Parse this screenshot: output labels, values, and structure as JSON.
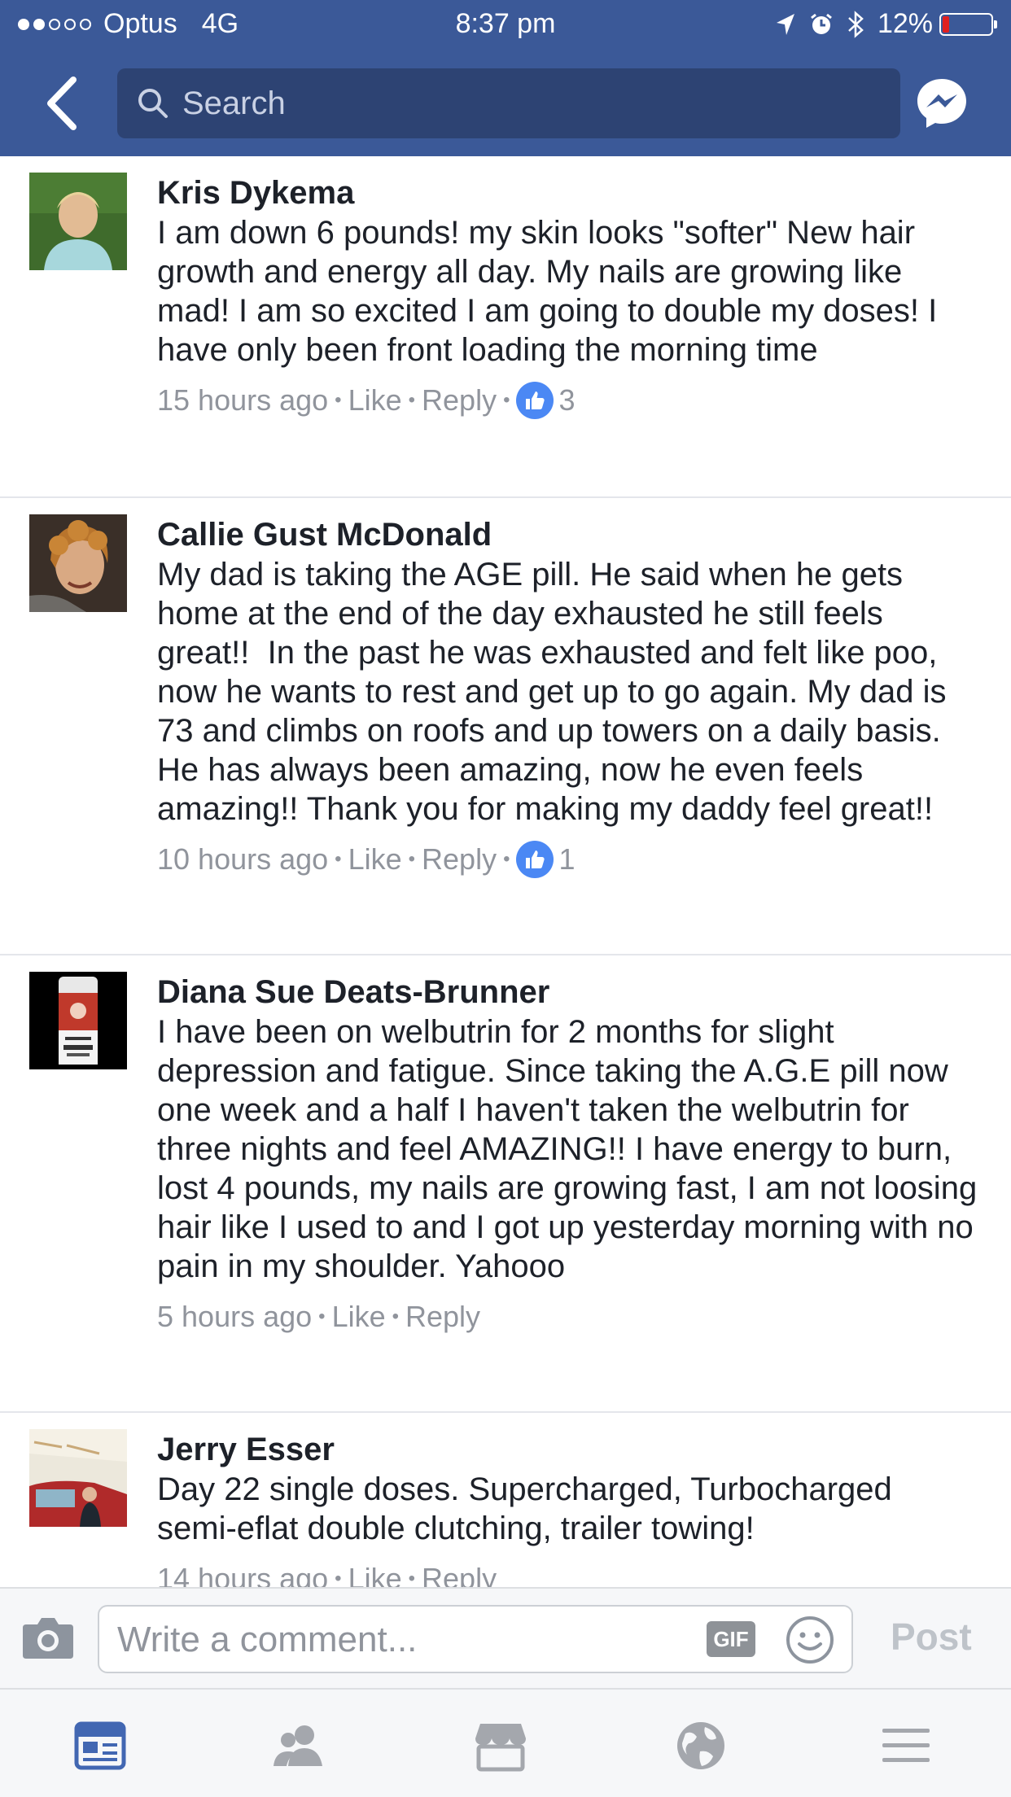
{
  "status_bar": {
    "carrier": "Optus",
    "network": "4G",
    "time": "8:37 pm",
    "battery": "12%",
    "signal_bars": 2
  },
  "nav": {
    "search_placeholder": "Search"
  },
  "comments": [
    {
      "name": "Kris Dykema",
      "text": "I am down 6 pounds! my skin looks \"softer\" New hair growth and energy all day. My nails are growing like mad! I am so excited I am going to double my doses! I have only been front loading the morning time",
      "time": "15 hours ago",
      "like": "Like",
      "reply": "Reply",
      "likes": "3"
    },
    {
      "name": "Callie Gust McDonald",
      "text": "My dad is taking the AGE pill. He said when he gets home at the end of the day exhausted he still feels great!!  In the past he was exhausted and felt like poo, now he wants to rest and get up to go again. My dad is 73 and climbs on roofs and up towers on a daily basis.  He has always been amazing, now he even feels amazing!! Thank you for making my daddy feel great!!",
      "time": "10 hours ago",
      "like": "Like",
      "reply": "Reply",
      "likes": "1"
    },
    {
      "name": "Diana Sue Deats-Brunner",
      "text": "I have been on welbutrin for 2 months for slight depression and fatigue. Since taking the A.G.E pill now one week and a half I haven't taken the welbutrin for three nights and feel AMAZING!! I have energy to burn, lost 4 pounds, my nails are growing fast, I am not loosing hair like I used to and I got up yesterday morning with no pain in my shoulder. Yahooo",
      "time": "5 hours ago",
      "like": "Like",
      "reply": "Reply"
    },
    {
      "name": "Jerry Esser",
      "text": "Day 22 single doses. Supercharged, Turbocharged semi-eflat double clutching, trailer towing!",
      "time": "14 hours ago",
      "like": "Like",
      "reply": "Reply"
    }
  ],
  "composer": {
    "placeholder": "Write a comment...",
    "gif_label": "GIF",
    "post_label": "Post"
  },
  "tabbar": {
    "tabs": [
      "news-feed-icon",
      "friends-icon",
      "marketplace-icon",
      "notifications-globe-icon",
      "menu-icon"
    ],
    "active_color": "#4267b2",
    "inactive_color": "#a4a7ad"
  },
  "colors": {
    "brand": "#3b5998",
    "search_bg": "#2d4373",
    "like_blue": "#4b88f4",
    "meta_gray": "#90949c"
  }
}
